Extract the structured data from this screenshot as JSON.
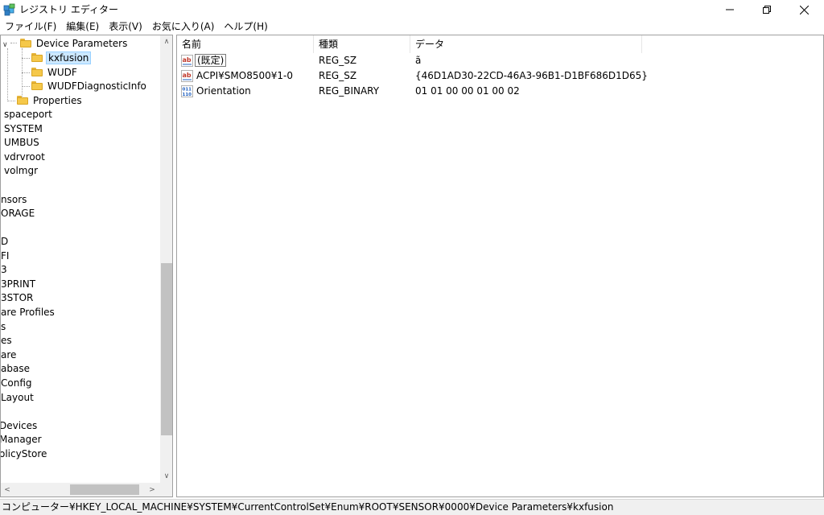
{
  "window": {
    "title": "レジストリ エディター"
  },
  "menu": {
    "items": [
      "ファイル(F)",
      "編集(E)",
      "表示(V)",
      "お気に入り(A)",
      "ヘルプ(H)"
    ]
  },
  "tree": {
    "items": [
      {
        "label": "Device Parameters",
        "folder": true,
        "expanded": true
      },
      {
        "label": "kxfusion",
        "folder": true,
        "selected": true
      },
      {
        "label": "WUDF",
        "folder": true
      },
      {
        "label": "WUDFDiagnosticInfo",
        "folder": true
      },
      {
        "label": "Properties",
        "folder": true
      },
      {
        "label": "spaceport"
      },
      {
        "label": "SYSTEM"
      },
      {
        "label": "UMBUS"
      },
      {
        "label": "vdrvroot"
      },
      {
        "label": "volmgr"
      },
      {
        "label": ""
      },
      {
        "label": "nsors"
      },
      {
        "label": "ORAGE"
      },
      {
        "label": ""
      },
      {
        "label": "D"
      },
      {
        "label": "FI"
      },
      {
        "label": "3"
      },
      {
        "label": "3PRINT"
      },
      {
        "label": "3STOR"
      },
      {
        "label": "are Profiles"
      },
      {
        "label": "s"
      },
      {
        "label": "es"
      },
      {
        "label": "are"
      },
      {
        "label": "abase"
      },
      {
        "label": "Config"
      },
      {
        "label": "Layout"
      },
      {
        "label": ""
      },
      {
        "label": "Devices"
      },
      {
        "label": "Manager"
      },
      {
        "label": "olicyStore"
      }
    ]
  },
  "list": {
    "columns": [
      "名前",
      "種類",
      "データ"
    ],
    "rows": [
      {
        "icon": "string-value-icon",
        "name": "(既定)",
        "type": "REG_SZ",
        "data": "ã"
      },
      {
        "icon": "string-value-icon",
        "name": "ACPI¥SMO8500¥1-0",
        "type": "REG_SZ",
        "data": "{46D1AD30-22CD-46A3-96B1-D1BF686D1D65}"
      },
      {
        "icon": "binary-value-icon",
        "name": "Orientation",
        "type": "REG_BINARY",
        "data": "01 01 00 00 01 00 02"
      }
    ]
  },
  "status": {
    "path": "コンピューター¥HKEY_LOCAL_MACHINE¥SYSTEM¥CurrentControlSet¥Enum¥ROOT¥SENSOR¥0000¥Device Parameters¥kxfusion"
  },
  "colors": {
    "selection": "#cce8ff",
    "folder": "#f5c84a",
    "string_icon_red": "#c0392b",
    "binary_icon_blue": "#1f5fbf"
  }
}
